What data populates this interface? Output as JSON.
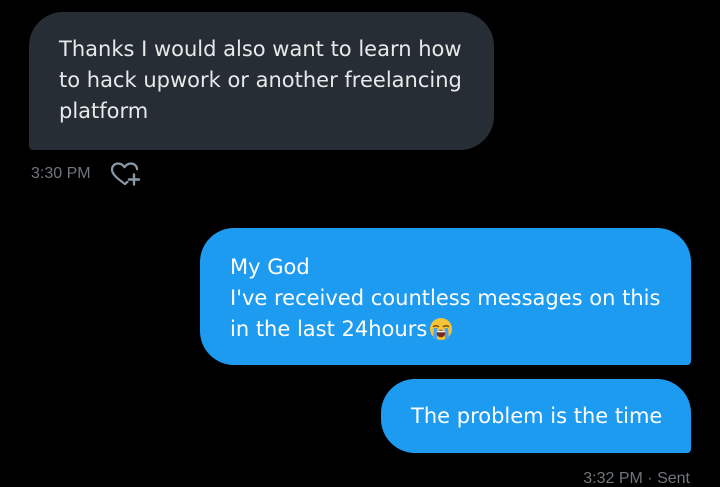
{
  "messages": [
    {
      "direction": "received",
      "text": "Thanks I would also want to learn how\nto hack upwork or another freelancing\nplatform",
      "time": "3:30 PM"
    },
    {
      "direction": "sent",
      "text": "My God\nI've received countless messages on this\nin the last 24hours",
      "emoji": "loudly-crying-face"
    },
    {
      "direction": "sent",
      "text": "The problem is the time",
      "status": "3:32 PM · Sent"
    }
  ],
  "icons": {
    "react": "heart-plus-icon",
    "emoji": "loudly-crying-face-emoji"
  },
  "colors": {
    "background": "#000000",
    "received_bubble": "#262d34",
    "sent_bubble": "#1d9bf0",
    "meta_text": "#71767b"
  }
}
